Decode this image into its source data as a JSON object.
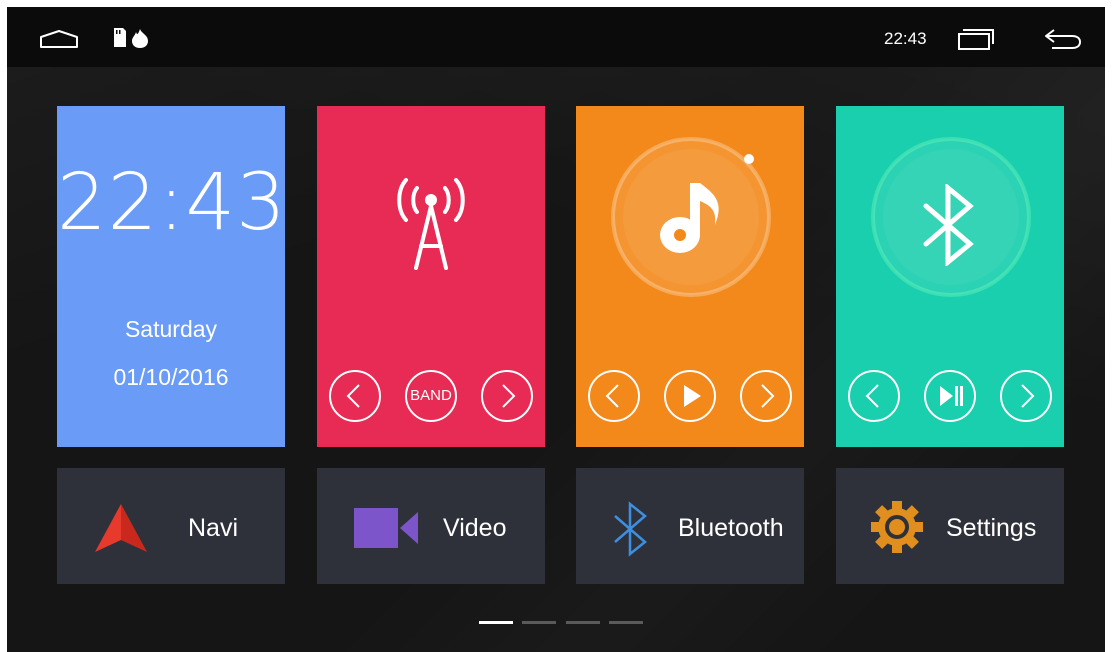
{
  "status_bar": {
    "time": "22:43",
    "icons": [
      "home-icon",
      "sd-card-icon",
      "tasks-icon",
      "back-icon"
    ]
  },
  "clock_tile": {
    "time": "22:43",
    "weekday": "Saturday",
    "date": "01/10/2016",
    "color": "#6a9bf6"
  },
  "radio_tile": {
    "icon": "radio-tower-icon",
    "band_label": "BAND",
    "color": "#e82b54"
  },
  "music_tile": {
    "icon": "music-note-icon",
    "color": "#f3891a"
  },
  "bt_tile": {
    "icon": "bluetooth-icon",
    "color": "#19cfae"
  },
  "shortcuts": [
    {
      "label": "Navi",
      "icon": "navigation-arrow-icon",
      "icon_color": "#e03a2c"
    },
    {
      "label": "Video",
      "icon": "video-camera-icon",
      "icon_color": "#7b55c9"
    },
    {
      "label": "Bluetooth",
      "icon": "bluetooth-icon",
      "icon_color": "#3d8fe0"
    },
    {
      "label": "Settings",
      "icon": "gear-icon",
      "icon_color": "#e08f1e"
    }
  ],
  "pagination": {
    "pages": 4,
    "current": 1
  }
}
